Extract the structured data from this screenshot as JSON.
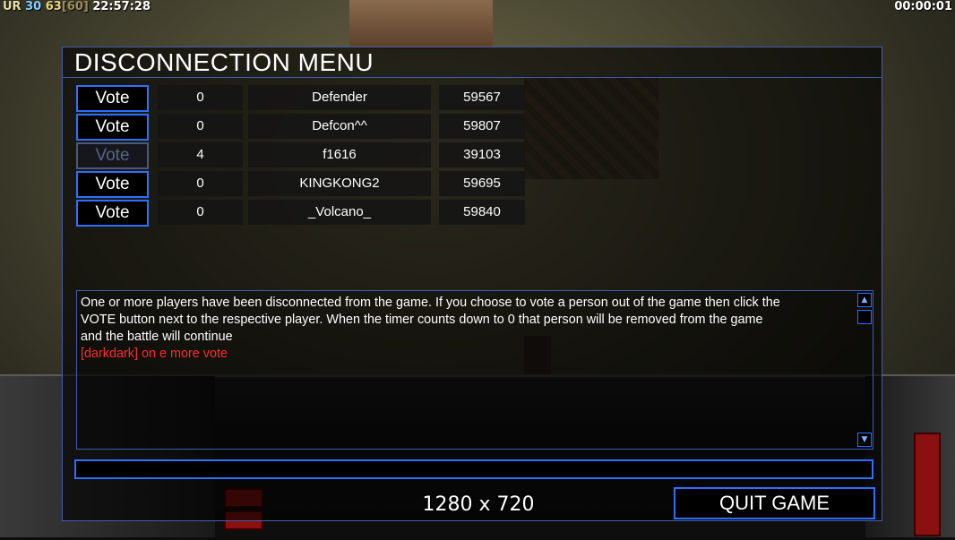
{
  "hud": {
    "ur_label": "UR",
    "fps": "30",
    "ping": "63",
    "ping_bracket": "[60]",
    "clock": "22:57:28",
    "game_timer": "00:00:01"
  },
  "dialog": {
    "title": "DISCONNECTION MENU",
    "vote_label": "Vote",
    "players": [
      {
        "votes": "0",
        "name": "Defender",
        "ping": "59567",
        "vote_enabled": true
      },
      {
        "votes": "0",
        "name": "Defcon^^",
        "ping": "59807",
        "vote_enabled": true
      },
      {
        "votes": "4",
        "name": "f1616",
        "ping": "39103",
        "vote_enabled": false
      },
      {
        "votes": "0",
        "name": "KINGKONG2",
        "ping": "59695",
        "vote_enabled": true
      },
      {
        "votes": "0",
        "name": "_Volcano_",
        "ping": "59840",
        "vote_enabled": true
      }
    ],
    "message_lines": [
      "One or more players have been disconnected from the game. If you choose to vote a person out of the game then click the",
      " VOTE button next to the respective player. When the timer counts down to 0 that person will be removed from the game",
      " and the battle will continue"
    ],
    "alert_message": "[darkdark] on e more vote",
    "chat_input_value": "",
    "quit_label": "QUIT GAME",
    "resolution_label": "1280 x 720"
  },
  "colors": {
    "frame_blue": "#3f5db0",
    "button_border": "#2f6fff",
    "alert_red": "#ff2a2a"
  }
}
